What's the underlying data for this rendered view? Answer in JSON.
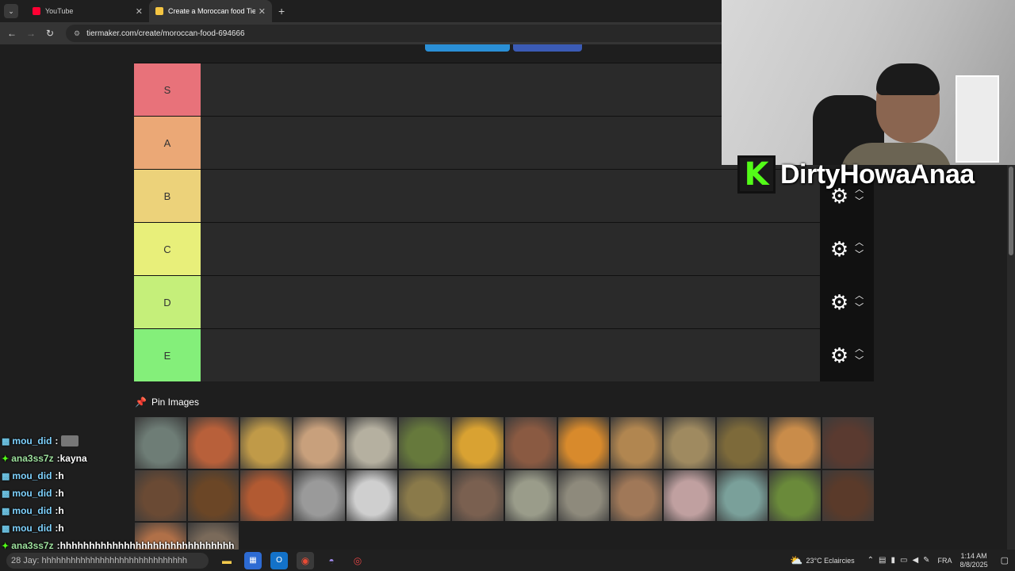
{
  "browser": {
    "tabs": [
      {
        "title": "YouTube",
        "active": false,
        "favicon_color": "#ff0033"
      },
      {
        "title": "Create a Moroccan food Tier Li",
        "active": true,
        "favicon_color": "#f5c542"
      }
    ],
    "url": "tiermaker.com/create/moroccan-food-694666"
  },
  "tiers": [
    {
      "label": "S",
      "color": "#e8727a"
    },
    {
      "label": "A",
      "color": "#eba876"
    },
    {
      "label": "B",
      "color": "#ecd27a"
    },
    {
      "label": "C",
      "color": "#e8ef7a"
    },
    {
      "label": "D",
      "color": "#c5ef7a"
    },
    {
      "label": "E",
      "color": "#84ef7a"
    }
  ],
  "pin_images_label": "Pin Images",
  "image_tiles": [
    "#6e7d76",
    "#b8603a",
    "#c09a48",
    "#c8a07c",
    "#b5b0a0",
    "#66793c",
    "#d9a232",
    "#8a5a42",
    "#d88a2c",
    "#b18650",
    "#9f8a60",
    "#7d6a3a",
    "#c98c4a",
    "#5a3a30",
    "#6a4a34",
    "#6b4626",
    "#b25a32",
    "#9a9a9a",
    "#cfcfcf",
    "#8a7a4a",
    "#7a6050",
    "#9a9c8a",
    "#8e8a7c",
    "#a07858",
    "#c0a0a0",
    "#7aa09a",
    "#6a8a3a",
    "#5a3a2a",
    "#b07048",
    "#7a6a5a"
  ],
  "streamer": {
    "name": "DirtyHowaAnaa",
    "logo_letter": "K",
    "accent": "#53fc18"
  },
  "chat": [
    {
      "badge": "▩",
      "user": "mou_did",
      "message": "",
      "emote": true
    },
    {
      "badge": "✦",
      "user": "ana3ss7z",
      "message": "kayna",
      "emote": false
    },
    {
      "badge": "▩",
      "user": "mou_did",
      "message": "h",
      "emote": false
    },
    {
      "badge": "▩",
      "user": "mou_did",
      "message": "h",
      "emote": false
    },
    {
      "badge": "▩",
      "user": "mou_did",
      "message": "h",
      "emote": false
    },
    {
      "badge": "▩",
      "user": "mou_did",
      "message": "h",
      "emote": false
    },
    {
      "badge": "✦",
      "user": "ana3ss7z",
      "message": "hhhhhhhhhhhhhhhhhhhhhhhhhhhhhh",
      "emote": false
    }
  ],
  "taskbar": {
    "search_text": "28 Jay: hhhhhhhhhhhhhhhhhhhhhhhhhhhhhh",
    "weather": "23°C  Eclaircies",
    "language": "FRA",
    "time": "1:14 AM",
    "date": "8/8/2025"
  }
}
